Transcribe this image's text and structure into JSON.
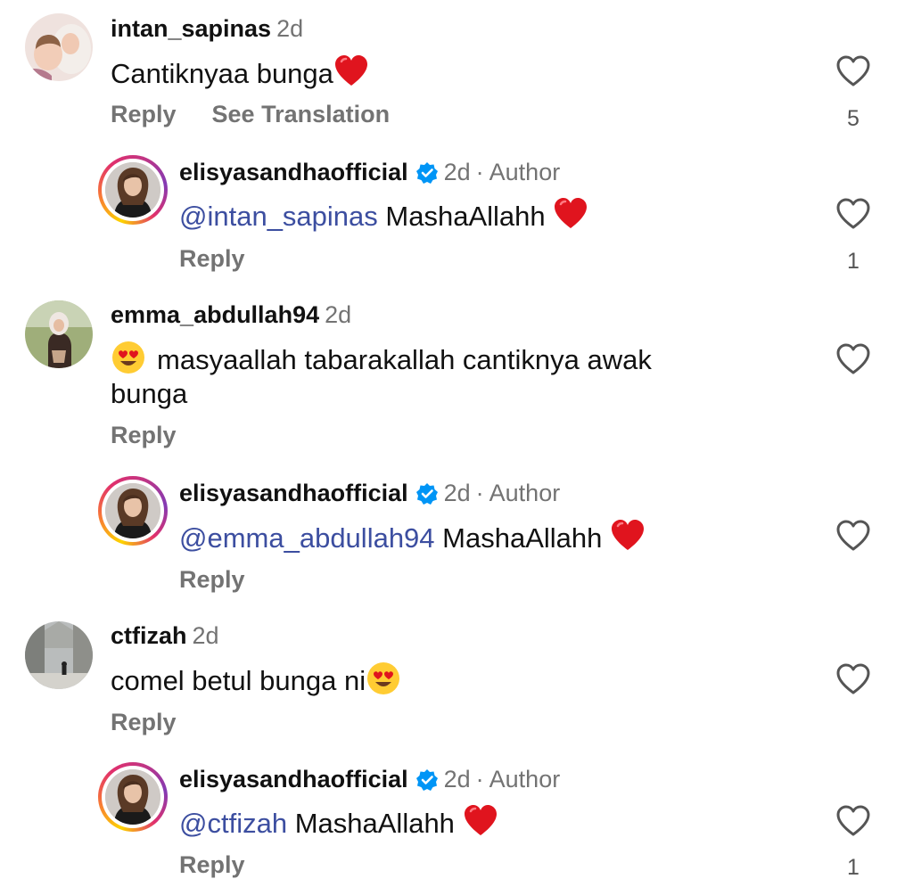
{
  "comments": [
    {
      "username": "intan_sapinas",
      "time": "2d",
      "text": "Cantiknyaa bunga",
      "emoji_after": "red-heart",
      "actions": [
        "Reply",
        "See Translation"
      ],
      "likes": "5",
      "reply": {
        "username": "elisyasandhaofficial",
        "time": "2d",
        "author_tag": "Author",
        "mention": "@intan_sapinas",
        "text": "MashaAllahh",
        "emoji_after": "red-heart",
        "action": "Reply",
        "likes": "1"
      }
    },
    {
      "username": "emma_abdullah94",
      "time": "2d",
      "emoji_before": "heart-eyes",
      "text": "masyaallah tabarakallah cantiknya awak",
      "text_line2": "bunga",
      "actions": [
        "Reply"
      ],
      "likes": "",
      "reply": {
        "username": "elisyasandhaofficial",
        "time": "2d",
        "author_tag": "Author",
        "mention": "@emma_abdullah94",
        "text": "MashaAllahh",
        "emoji_after": "red-heart",
        "action": "Reply",
        "likes": ""
      }
    },
    {
      "username": "ctfizah",
      "time": "2d",
      "text": "comel betul bunga ni",
      "emoji_after": "heart-eyes",
      "actions": [
        "Reply"
      ],
      "likes": "",
      "reply": {
        "username": "elisyasandhaofficial",
        "time": "2d",
        "author_tag": "Author",
        "mention": "@ctfizah",
        "text": "MashaAllahh",
        "emoji_after": "red-heart",
        "action": "Reply",
        "likes": "1"
      }
    }
  ],
  "separator": "·",
  "colors": {
    "mention": "#3c4ea0",
    "meta": "#737373",
    "verified": "#0095f6",
    "heart": "#e0141e"
  }
}
